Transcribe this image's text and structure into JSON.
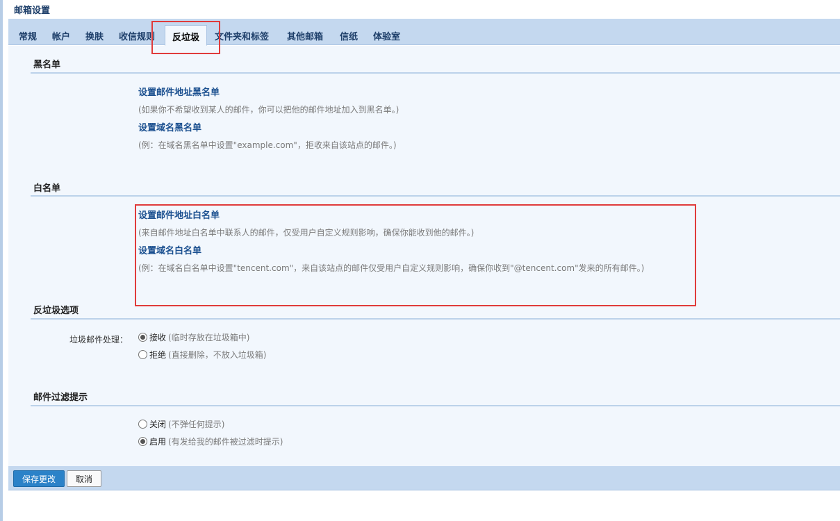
{
  "page": {
    "title": "邮箱设置"
  },
  "tabs": [
    {
      "label": "常规"
    },
    {
      "label": "帐户"
    },
    {
      "label": "换肤"
    },
    {
      "label": "收信规则"
    },
    {
      "label": "反垃圾",
      "active": true
    },
    {
      "label": "文件夹和标签"
    },
    {
      "label": "其他邮箱"
    },
    {
      "label": "信纸"
    },
    {
      "label": "体验室"
    }
  ],
  "blacklist": {
    "title": "黑名单",
    "address_link": "设置邮件地址黑名单",
    "address_desc": "(如果你不希望收到某人的邮件，你可以把他的邮件地址加入到黑名单。)",
    "domain_link": "设置域名黑名单",
    "domain_desc": "(例：在域名黑名单中设置\"example.com\"，拒收来自该站点的邮件。)"
  },
  "whitelist": {
    "title": "白名单",
    "address_link": "设置邮件地址白名单",
    "address_desc": "(来自邮件地址白名单中联系人的邮件，仅受用户自定义规则影响，确保你能收到他的邮件。)",
    "domain_link": "设置域名白名单",
    "domain_desc": "(例：在域名白名单中设置\"tencent.com\"，来自该站点的邮件仅受用户自定义规则影响，确保你收到\"@tencent.com\"发来的所有邮件。)"
  },
  "antispam": {
    "title": "反垃圾选项",
    "field_label": "垃圾邮件处理：",
    "options": [
      {
        "label": "接收",
        "hint": "(临时存放在垃圾箱中)",
        "checked": true
      },
      {
        "label": "拒绝",
        "hint": "(直接删除，不放入垃圾箱)",
        "checked": false
      }
    ]
  },
  "filter_notice": {
    "title": "邮件过滤提示",
    "options": [
      {
        "label": "关闭",
        "hint": "(不弹任何提示)",
        "checked": false
      },
      {
        "label": "启用",
        "hint": "(有发给我的邮件被过滤时提示)",
        "checked": true
      }
    ]
  },
  "footer": {
    "save_label": "保存更改",
    "cancel_label": "取消"
  },
  "colors": {
    "tab_bar": "#c4d8ef",
    "content_bg": "#f2f7fd",
    "link": "#1a4f8f",
    "highlight": "#e03b3b",
    "save_button": "#2b82c8"
  }
}
